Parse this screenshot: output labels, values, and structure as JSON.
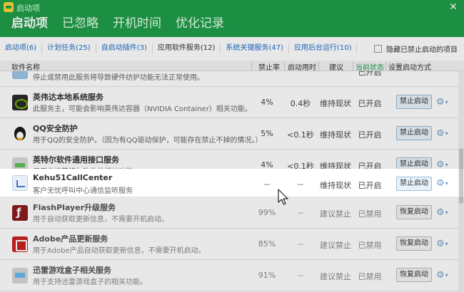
{
  "window": {
    "title": "启动项"
  },
  "main_tabs": [
    {
      "label": "启动项",
      "active": true
    },
    {
      "label": "已忽略",
      "active": false
    },
    {
      "label": "开机时间",
      "active": false
    },
    {
      "label": "优化记录",
      "active": false
    }
  ],
  "sub_tabs": [
    {
      "label": "启动项(6)"
    },
    {
      "label": "计划任务(25)"
    },
    {
      "label": "自启动插件(3)"
    },
    {
      "label": "应用软件服务(12)"
    },
    {
      "label": "系统关键服务(47)"
    },
    {
      "label": "应用后台运行(10)"
    }
  ],
  "hide_disabled_label": "隐藏已禁止启动的项目",
  "columns": {
    "name": "软件名称",
    "rate": "禁止率",
    "time": "启动用时",
    "advice": "建议",
    "state": "当前状态",
    "action": "设置启动方式"
  },
  "rows": [
    {
      "name": "",
      "desc": "停止或禁用此服务将导致硬件纺护功能无法正常使用。",
      "rate": "",
      "time": "",
      "advice": "",
      "state": "已开启",
      "action": "",
      "icon": "partial-icon"
    },
    {
      "name": "英伟达本地系统服务",
      "desc": "此服务主，可能会影响英伟达容器（NVIDIA Container）相关功能。",
      "rate": "4%",
      "time": "0.4秒",
      "advice": "维持现状",
      "state": "已开启",
      "action": "禁止启动",
      "icon": "nvidia-icon"
    },
    {
      "name": "QQ安全防护",
      "desc": "用于QQ的安全防护。（因为有QQ驱动保护，可能存在禁止不掉的情况。）",
      "rate": "5%",
      "time": "<0.1秒",
      "advice": "维持现状",
      "state": "已开启",
      "action": "禁止启动",
      "icon": "qq-icon"
    },
    {
      "name": "英特尔软件通用接口服务",
      "desc": "用于支持英特尔软件的相关功能。",
      "rate": "4%",
      "time": "<0.1秒",
      "advice": "维持现状",
      "state": "已开启",
      "action": "禁止启动",
      "icon": "intel-icon"
    },
    {
      "name": "Kehu51CallCenter",
      "desc": "客户无忧呼叫中心通信监听服务",
      "rate": "--",
      "time": "--",
      "advice": "维持现状",
      "state": "已开启",
      "action": "禁止启动",
      "icon": "kehu-icon"
    },
    {
      "name": "FlashPlayer升级服务",
      "desc": "用于自动获取更新信息，不需要开机启动。",
      "rate": "99%",
      "time": "--",
      "advice": "建议禁止",
      "state": "已禁用",
      "action": "恢复启动",
      "icon": "flash-icon"
    },
    {
      "name": "Adobe产品更新服务",
      "desc": "用于Adobe产品自动获取更新信息，不需要开机启动。",
      "rate": "85%",
      "time": "--",
      "advice": "建议禁止",
      "state": "已禁用",
      "action": "恢复启动",
      "icon": "adobe-icon"
    },
    {
      "name": "迅雷游戏盒子相关服务",
      "desc": "用于支持迅雷游戏盒子的相关功能。",
      "rate": "91%",
      "time": "--",
      "advice": "建议禁止",
      "state": "已禁用",
      "action": "恢复启动",
      "icon": "xunlei-icon"
    }
  ],
  "colors": {
    "header": "#1f9e4a",
    "link": "#1f6fc8"
  }
}
